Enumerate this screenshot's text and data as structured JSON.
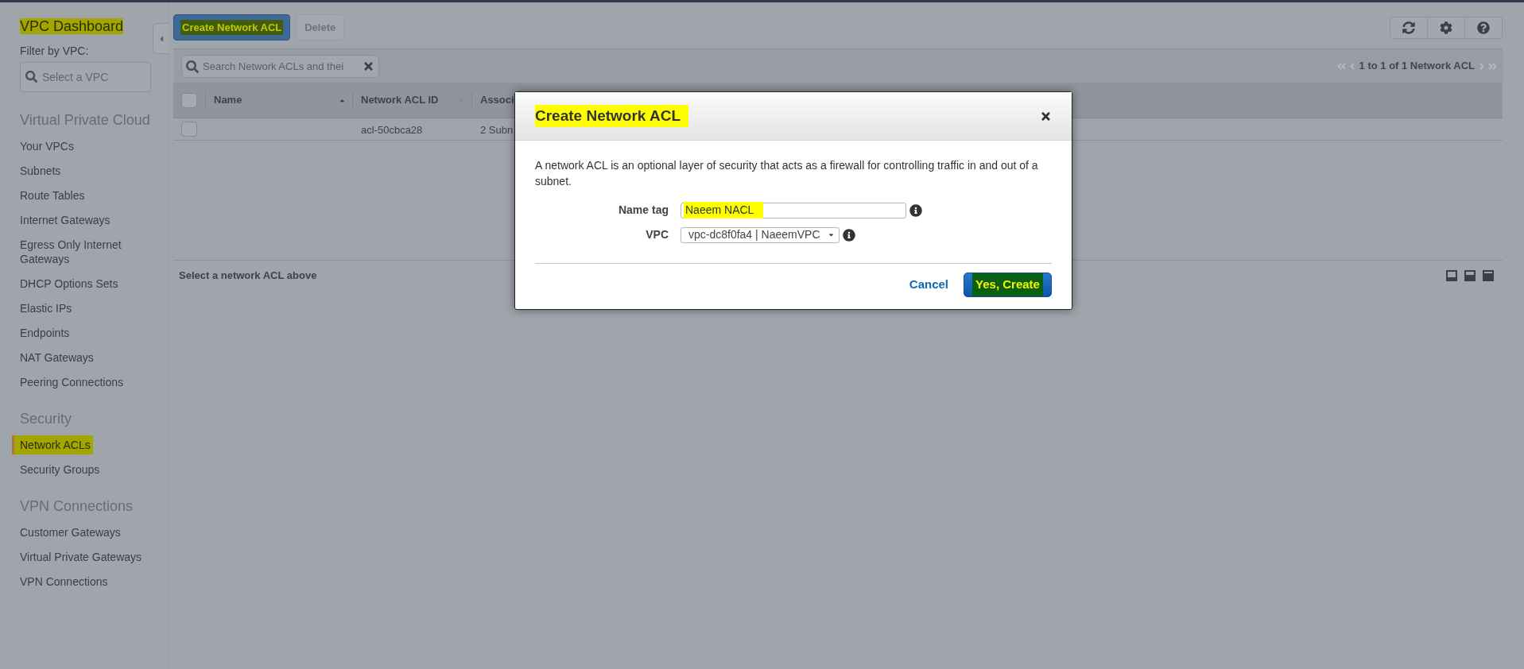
{
  "sidebar": {
    "title": {
      "text": "VPC Dashboard",
      "highlighted": true
    },
    "filter": {
      "label": "Filter by VPC:",
      "placeholder": "Select a VPC"
    },
    "sections": [
      {
        "heading": "Virtual Private Cloud",
        "items": [
          {
            "label": "Your VPCs",
            "selected": false,
            "highlighted": false
          },
          {
            "label": "Subnets",
            "selected": false,
            "highlighted": false
          },
          {
            "label": "Route Tables",
            "selected": false,
            "highlighted": false
          },
          {
            "label": "Internet Gateways",
            "selected": false,
            "highlighted": false
          },
          {
            "label": "Egress Only Internet Gateways",
            "selected": false,
            "highlighted": false
          },
          {
            "label": "DHCP Options Sets",
            "selected": false,
            "highlighted": false
          },
          {
            "label": "Elastic IPs",
            "selected": false,
            "highlighted": false
          },
          {
            "label": "Endpoints",
            "selected": false,
            "highlighted": false
          },
          {
            "label": "NAT Gateways",
            "selected": false,
            "highlighted": false
          },
          {
            "label": "Peering Connections",
            "selected": false,
            "highlighted": false
          }
        ]
      },
      {
        "heading": "Security",
        "items": [
          {
            "label": "Network ACLs",
            "selected": true,
            "highlighted": true
          },
          {
            "label": "Security Groups",
            "selected": false,
            "highlighted": false
          }
        ]
      },
      {
        "heading": "VPN Connections",
        "items": [
          {
            "label": "Customer Gateways",
            "selected": false,
            "highlighted": false
          },
          {
            "label": "Virtual Private Gateways",
            "selected": false,
            "highlighted": false
          },
          {
            "label": "VPN Connections",
            "selected": false,
            "highlighted": false
          }
        ]
      }
    ]
  },
  "toolbar": {
    "buttons": [
      {
        "label": "Create Network ACL",
        "kind": "primary",
        "disabled": false,
        "highlighted": true
      },
      {
        "label": "Delete",
        "kind": "secondary",
        "disabled": true,
        "highlighted": false
      }
    ]
  },
  "filter_bar": {
    "search": {
      "placeholder": "Search Network ACLs and thei"
    },
    "pagination": "1 to 1 of 1 Network ACL"
  },
  "table": {
    "select_all": {
      "checked": false
    },
    "columns": [
      {
        "label": "Name",
        "kind": "sorted"
      },
      {
        "label": "Network ACL ID",
        "kind": "sortable"
      },
      {
        "label": "Associ",
        "kind": "plain"
      }
    ],
    "rows": [
      {
        "checked": false,
        "network_acl_id": "acl-50cbca28",
        "column_3": "2 Subn"
      }
    ]
  },
  "detail_pane": {
    "message": "Select a network ACL above"
  },
  "modal": {
    "title": {
      "text": "Create Network ACL",
      "highlighted": true
    },
    "description": "A network ACL is an optional layer of security that acts as a firewall for controlling traffic in and out of a subnet.",
    "fields": [
      {
        "label": "Name tag",
        "kind": "text",
        "value": "Naeem NACL",
        "highlighted": true
      },
      {
        "label": "VPC",
        "kind": "select",
        "value": "vpc-dc8f0fa4 | NaeemVPC",
        "highlighted": false
      }
    ],
    "buttons": [
      {
        "label": "Cancel",
        "kind": "link",
        "highlighted": false
      },
      {
        "label": "Yes, Create",
        "kind": "primary",
        "highlighted": true
      }
    ]
  }
}
